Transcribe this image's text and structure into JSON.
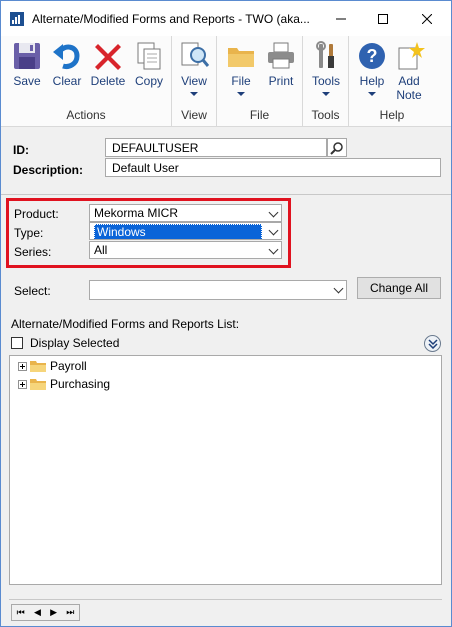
{
  "window": {
    "title": "Alternate/Modified Forms and Reports  -  TWO (aka..."
  },
  "ribbon": {
    "groups": [
      {
        "label": "Actions",
        "buttons": [
          {
            "label": "Save"
          },
          {
            "label": "Clear"
          },
          {
            "label": "Delete"
          },
          {
            "label": "Copy"
          }
        ]
      },
      {
        "label": "View",
        "buttons": [
          {
            "label": "View"
          }
        ]
      },
      {
        "label": "File",
        "buttons": [
          {
            "label": "File"
          },
          {
            "label": "Print"
          }
        ]
      },
      {
        "label": "Tools",
        "buttons": [
          {
            "label": "Tools"
          }
        ]
      },
      {
        "label": "Help",
        "buttons": [
          {
            "label": "Help"
          },
          {
            "label": "Add\nNote"
          }
        ]
      }
    ]
  },
  "id_section": {
    "id_label": "ID:",
    "id_value": "DEFAULTUSER",
    "description_label": "Description:",
    "description_value": "Default User"
  },
  "filters": {
    "product_label": "Product:",
    "product_value": "Mekorma MICR",
    "type_label": "Type:",
    "type_value": "Windows",
    "series_label": "Series:",
    "series_value": "All",
    "select_label": "Select:",
    "select_value": "",
    "change_all_label": "Change All"
  },
  "list": {
    "title": "Alternate/Modified Forms and Reports List:",
    "display_selected_label": "Display Selected",
    "display_selected_checked": false,
    "items": [
      {
        "label": "Payroll"
      },
      {
        "label": "Purchasing"
      }
    ]
  },
  "colors": {
    "highlight_border": "#e0121f",
    "selection_bg": "#0a64d8",
    "ribbon_text": "#1e3f7a"
  }
}
